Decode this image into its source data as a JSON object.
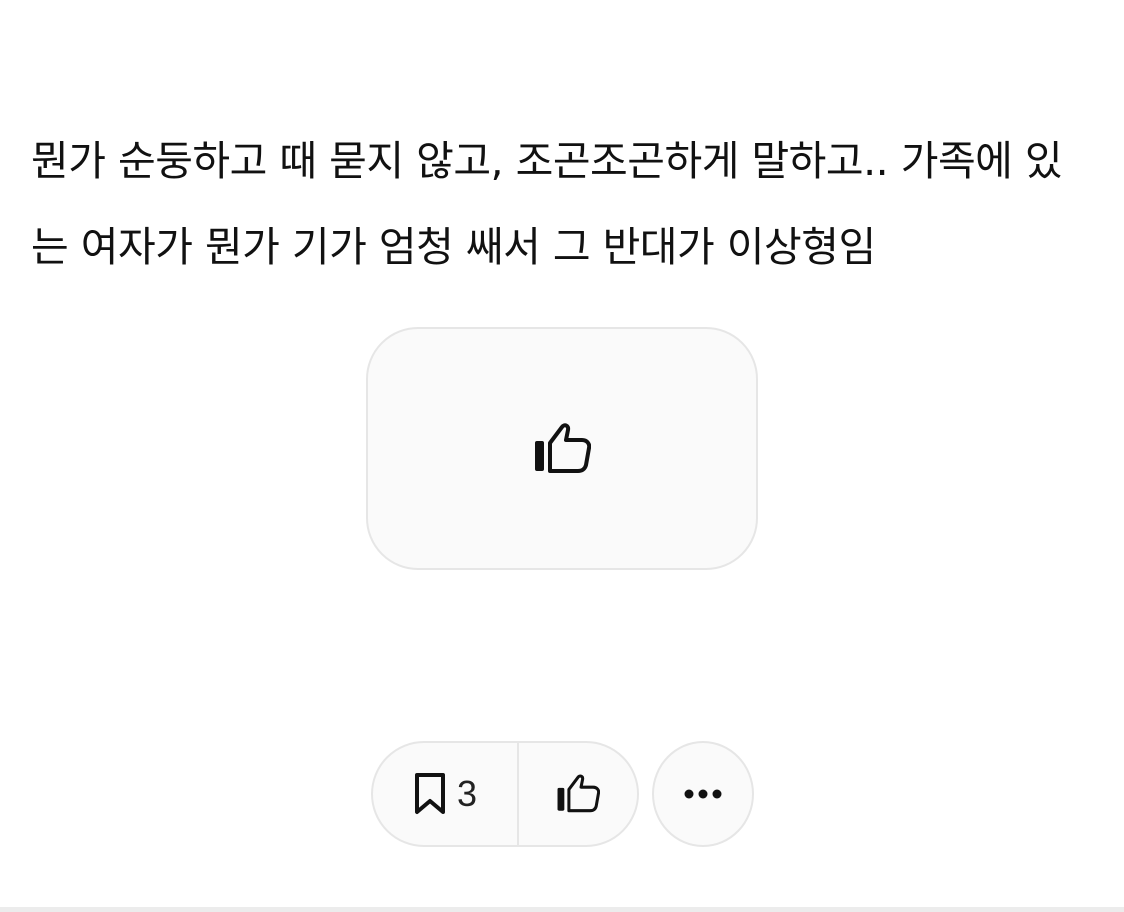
{
  "post": {
    "body_text": "뭔가 순둥하고 때 묻지 않고, 조곤조곤하게 말하고.. 가족에 있는 여자가 뭔가 기가 엄청 쌔서 그 반대가 이상형임"
  },
  "actions": {
    "bookmark_count": "3",
    "like_icon": "thumbs-up-icon",
    "bookmark_icon": "bookmark-icon",
    "more_icon": "more-horizontal-icon"
  }
}
